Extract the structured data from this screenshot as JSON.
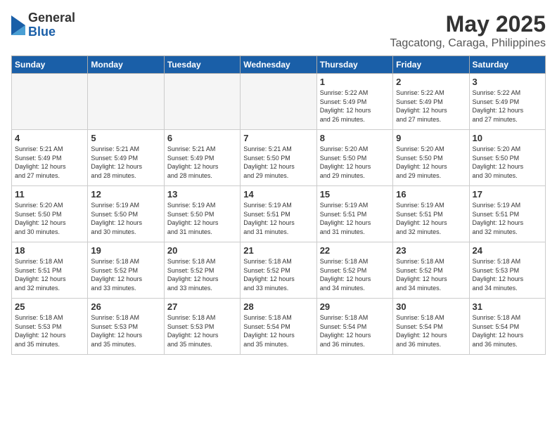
{
  "header": {
    "logo": {
      "general": "General",
      "blue": "Blue"
    },
    "title": "May 2025",
    "location": "Tagcatong, Caraga, Philippines"
  },
  "days_of_week": [
    "Sunday",
    "Monday",
    "Tuesday",
    "Wednesday",
    "Thursday",
    "Friday",
    "Saturday"
  ],
  "weeks": [
    [
      {
        "day": "",
        "info": "",
        "empty": true
      },
      {
        "day": "",
        "info": "",
        "empty": true
      },
      {
        "day": "",
        "info": "",
        "empty": true
      },
      {
        "day": "",
        "info": "",
        "empty": true
      },
      {
        "day": "1",
        "info": "Sunrise: 5:22 AM\nSunset: 5:49 PM\nDaylight: 12 hours\nand 26 minutes."
      },
      {
        "day": "2",
        "info": "Sunrise: 5:22 AM\nSunset: 5:49 PM\nDaylight: 12 hours\nand 27 minutes."
      },
      {
        "day": "3",
        "info": "Sunrise: 5:22 AM\nSunset: 5:49 PM\nDaylight: 12 hours\nand 27 minutes."
      }
    ],
    [
      {
        "day": "4",
        "info": "Sunrise: 5:21 AM\nSunset: 5:49 PM\nDaylight: 12 hours\nand 27 minutes."
      },
      {
        "day": "5",
        "info": "Sunrise: 5:21 AM\nSunset: 5:49 PM\nDaylight: 12 hours\nand 28 minutes."
      },
      {
        "day": "6",
        "info": "Sunrise: 5:21 AM\nSunset: 5:49 PM\nDaylight: 12 hours\nand 28 minutes."
      },
      {
        "day": "7",
        "info": "Sunrise: 5:21 AM\nSunset: 5:50 PM\nDaylight: 12 hours\nand 29 minutes."
      },
      {
        "day": "8",
        "info": "Sunrise: 5:20 AM\nSunset: 5:50 PM\nDaylight: 12 hours\nand 29 minutes."
      },
      {
        "day": "9",
        "info": "Sunrise: 5:20 AM\nSunset: 5:50 PM\nDaylight: 12 hours\nand 29 minutes."
      },
      {
        "day": "10",
        "info": "Sunrise: 5:20 AM\nSunset: 5:50 PM\nDaylight: 12 hours\nand 30 minutes."
      }
    ],
    [
      {
        "day": "11",
        "info": "Sunrise: 5:20 AM\nSunset: 5:50 PM\nDaylight: 12 hours\nand 30 minutes."
      },
      {
        "day": "12",
        "info": "Sunrise: 5:19 AM\nSunset: 5:50 PM\nDaylight: 12 hours\nand 30 minutes."
      },
      {
        "day": "13",
        "info": "Sunrise: 5:19 AM\nSunset: 5:50 PM\nDaylight: 12 hours\nand 31 minutes."
      },
      {
        "day": "14",
        "info": "Sunrise: 5:19 AM\nSunset: 5:51 PM\nDaylight: 12 hours\nand 31 minutes."
      },
      {
        "day": "15",
        "info": "Sunrise: 5:19 AM\nSunset: 5:51 PM\nDaylight: 12 hours\nand 31 minutes."
      },
      {
        "day": "16",
        "info": "Sunrise: 5:19 AM\nSunset: 5:51 PM\nDaylight: 12 hours\nand 32 minutes."
      },
      {
        "day": "17",
        "info": "Sunrise: 5:19 AM\nSunset: 5:51 PM\nDaylight: 12 hours\nand 32 minutes."
      }
    ],
    [
      {
        "day": "18",
        "info": "Sunrise: 5:18 AM\nSunset: 5:51 PM\nDaylight: 12 hours\nand 32 minutes."
      },
      {
        "day": "19",
        "info": "Sunrise: 5:18 AM\nSunset: 5:52 PM\nDaylight: 12 hours\nand 33 minutes."
      },
      {
        "day": "20",
        "info": "Sunrise: 5:18 AM\nSunset: 5:52 PM\nDaylight: 12 hours\nand 33 minutes."
      },
      {
        "day": "21",
        "info": "Sunrise: 5:18 AM\nSunset: 5:52 PM\nDaylight: 12 hours\nand 33 minutes."
      },
      {
        "day": "22",
        "info": "Sunrise: 5:18 AM\nSunset: 5:52 PM\nDaylight: 12 hours\nand 34 minutes."
      },
      {
        "day": "23",
        "info": "Sunrise: 5:18 AM\nSunset: 5:52 PM\nDaylight: 12 hours\nand 34 minutes."
      },
      {
        "day": "24",
        "info": "Sunrise: 5:18 AM\nSunset: 5:53 PM\nDaylight: 12 hours\nand 34 minutes."
      }
    ],
    [
      {
        "day": "25",
        "info": "Sunrise: 5:18 AM\nSunset: 5:53 PM\nDaylight: 12 hours\nand 35 minutes."
      },
      {
        "day": "26",
        "info": "Sunrise: 5:18 AM\nSunset: 5:53 PM\nDaylight: 12 hours\nand 35 minutes."
      },
      {
        "day": "27",
        "info": "Sunrise: 5:18 AM\nSunset: 5:53 PM\nDaylight: 12 hours\nand 35 minutes."
      },
      {
        "day": "28",
        "info": "Sunrise: 5:18 AM\nSunset: 5:54 PM\nDaylight: 12 hours\nand 35 minutes."
      },
      {
        "day": "29",
        "info": "Sunrise: 5:18 AM\nSunset: 5:54 PM\nDaylight: 12 hours\nand 36 minutes."
      },
      {
        "day": "30",
        "info": "Sunrise: 5:18 AM\nSunset: 5:54 PM\nDaylight: 12 hours\nand 36 minutes."
      },
      {
        "day": "31",
        "info": "Sunrise: 5:18 AM\nSunset: 5:54 PM\nDaylight: 12 hours\nand 36 minutes."
      }
    ]
  ]
}
